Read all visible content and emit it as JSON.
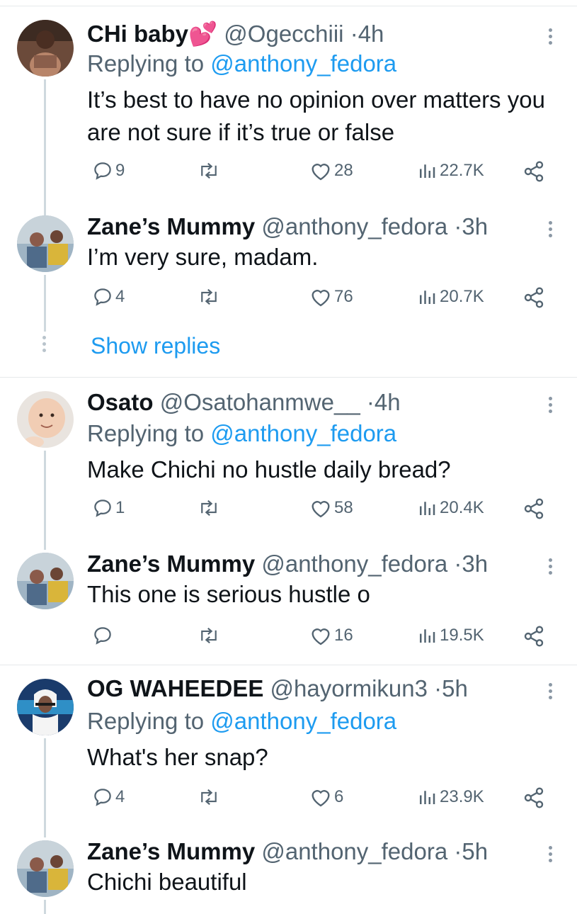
{
  "thread": [
    {
      "name": "CHi baby",
      "name_emoji": "💕",
      "handle": "@Ogecchiii",
      "time": "4h",
      "replying_prefix": "Replying to",
      "replying_to": "@anthony_fedora",
      "text": "It’s best to have no opinion over matters you are not sure if it’s true or false",
      "replies": "9",
      "likes": "28",
      "views": "22.7K"
    },
    {
      "name": "Zane’s Mummy",
      "handle": "@anthony_fedora",
      "time": "3h",
      "text": "I’m very sure, madam.",
      "replies": "4",
      "likes": "76",
      "views": "20.7K"
    },
    {
      "name": "Osato",
      "handle": "@Osatohanmwe__",
      "time": "4h",
      "replying_prefix": "Replying to",
      "replying_to": "@anthony_fedora",
      "text": "Make Chichi no hustle daily bread?",
      "replies": "1",
      "likes": "58",
      "views": "20.4K"
    },
    {
      "name": "Zane’s Mummy",
      "handle": "@anthony_fedora",
      "time": "3h",
      "text": "This one is serious hustle o",
      "replies": "",
      "likes": "16",
      "views": "19.5K"
    },
    {
      "name": "OG WAHEEDEE",
      "handle": "@hayormikun3",
      "time": "5h",
      "replying_prefix": "Replying to",
      "replying_to": "@anthony_fedora",
      "text": "What's her snap?",
      "replies": "4",
      "likes": "6",
      "views": "23.9K"
    },
    {
      "name": "Zane’s Mummy",
      "handle": "@anthony_fedora",
      "time": "5h",
      "text": "Chichi beautiful"
    }
  ],
  "show_replies": "Show replies",
  "separator": "·",
  "colors": {
    "link": "#1d9bf0",
    "secondary": "#536471",
    "primary": "#0f1419",
    "divider": "#e6e9eb",
    "thread_line": "#cfd9de"
  }
}
